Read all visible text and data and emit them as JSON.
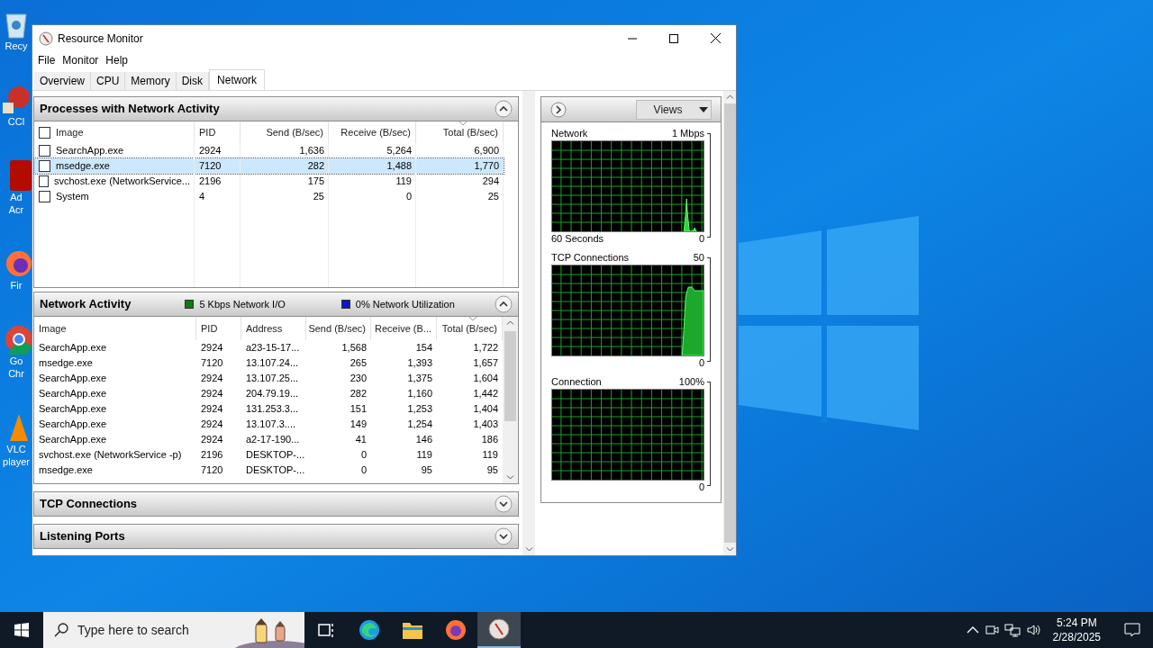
{
  "desktop_icons": [
    {
      "lines": [
        "Recy"
      ],
      "kind": "bin"
    },
    {
      "lines": [
        "CCl"
      ],
      "kind": "cleaner"
    },
    {
      "lines": [
        "Ad",
        "Acr"
      ],
      "kind": "acrobat"
    },
    {
      "lines": [
        "Fir"
      ],
      "kind": "firefox"
    },
    {
      "lines": [
        "Go",
        "Chr"
      ],
      "kind": "chrome"
    },
    {
      "lines": [
        "VLC",
        "player"
      ],
      "kind": "vlc"
    }
  ],
  "window": {
    "title": "Resource Monitor"
  },
  "menu": [
    "File",
    "Monitor",
    "Help"
  ],
  "tabs": [
    {
      "label": "Overview",
      "selected": false
    },
    {
      "label": "CPU",
      "selected": false
    },
    {
      "label": "Memory",
      "selected": false
    },
    {
      "label": "Disk",
      "selected": false
    },
    {
      "label": "Network",
      "selected": true
    }
  ],
  "processes": {
    "title": "Processes with Network Activity",
    "expanded": true,
    "all_checked": false,
    "columns": [
      {
        "label": "Image",
        "sorted": false
      },
      {
        "label": "PID",
        "sorted": false
      },
      {
        "label": "Send (B/sec)",
        "sorted": false
      },
      {
        "label": "Receive (B/sec)",
        "sorted": false
      },
      {
        "label": "Total (B/sec)",
        "sorted": true
      }
    ],
    "rows": [
      {
        "checked": false,
        "selected": false,
        "cells": [
          "SearchApp.exe",
          "2924",
          "1,636",
          "5,264",
          "6,900"
        ]
      },
      {
        "checked": false,
        "selected": true,
        "cells": [
          "msedge.exe",
          "7120",
          "282",
          "1,488",
          "1,770"
        ]
      },
      {
        "checked": false,
        "selected": false,
        "cells": [
          "svchost.exe (NetworkService...",
          "2196",
          "175",
          "119",
          "294"
        ]
      },
      {
        "checked": false,
        "selected": false,
        "cells": [
          "System",
          "4",
          "25",
          "0",
          "25"
        ]
      }
    ]
  },
  "network_activity": {
    "title": "Network Activity",
    "expanded": true,
    "legend": [
      {
        "text": "5 Kbps Network I/O",
        "color": "#0e7a12"
      },
      {
        "text": "0% Network Utilization",
        "color": "#0a18c8"
      }
    ],
    "columns": [
      {
        "label": "Image",
        "sorted": false
      },
      {
        "label": "PID",
        "sorted": false
      },
      {
        "label": "Address",
        "sorted": false
      },
      {
        "label": "Send (B/sec)",
        "sorted": false
      },
      {
        "label": "Receive (B...",
        "sorted": false
      },
      {
        "label": "Total (B/sec)",
        "sorted": true
      }
    ],
    "rows": [
      [
        "SearchApp.exe",
        "2924",
        "a23-15-17...",
        "1,568",
        "154",
        "1,722"
      ],
      [
        "msedge.exe",
        "7120",
        "13.107.24...",
        "265",
        "1,393",
        "1,657"
      ],
      [
        "SearchApp.exe",
        "2924",
        "13.107.25...",
        "230",
        "1,375",
        "1,604"
      ],
      [
        "SearchApp.exe",
        "2924",
        "204.79.19...",
        "282",
        "1,160",
        "1,442"
      ],
      [
        "SearchApp.exe",
        "2924",
        "131.253.3...",
        "151",
        "1,253",
        "1,404"
      ],
      [
        "SearchApp.exe",
        "2924",
        "13.107.3....",
        "149",
        "1,254",
        "1,403"
      ],
      [
        "SearchApp.exe",
        "2924",
        "a2-17-190...",
        "41",
        "146",
        "186"
      ],
      [
        "svchost.exe (NetworkService -p)",
        "2196",
        "DESKTOP-...",
        "0",
        "119",
        "119"
      ],
      [
        "msedge.exe",
        "7120",
        "DESKTOP-...",
        "0",
        "95",
        "95"
      ]
    ]
  },
  "collapsed_panels": [
    {
      "title": "TCP Connections",
      "expanded": false
    },
    {
      "title": "Listening Ports",
      "expanded": false
    }
  ],
  "graphs_panel": {
    "views_label": "Views",
    "graphs": [
      {
        "title": "Network",
        "max": "1 Mbps",
        "caption": "60 Seconds",
        "min": "0",
        "kind": "spike"
      },
      {
        "title": "TCP Connections",
        "max": "50",
        "min": "0",
        "kind": "plateau"
      },
      {
        "title": "Connection",
        "max": "100%",
        "min": "0",
        "kind": "flat"
      }
    ]
  },
  "taskbar": {
    "search_placeholder": "Type here to search",
    "apps": [
      {
        "kind": "task-view",
        "selected": false
      },
      {
        "kind": "edge",
        "selected": false
      },
      {
        "kind": "folder",
        "selected": false
      },
      {
        "kind": "firefox",
        "selected": false
      },
      {
        "kind": "resmon",
        "selected": true
      }
    ],
    "time": "5:24 PM",
    "date": "2/28/2025"
  }
}
